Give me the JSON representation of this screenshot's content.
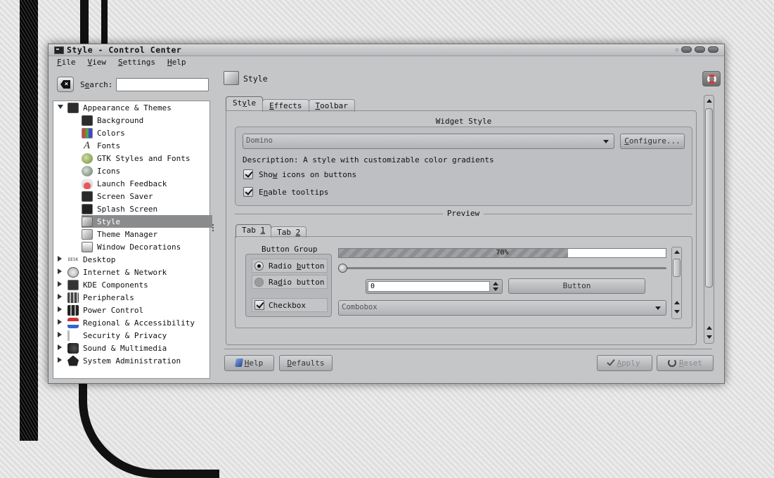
{
  "window": {
    "title": "Style - Control Center"
  },
  "menu": {
    "file": {
      "key": "F",
      "rest": "ile"
    },
    "view": {
      "key": "V",
      "rest": "iew"
    },
    "settings": {
      "key": "S",
      "rest": "ettings"
    },
    "help": {
      "key": "H",
      "rest": "elp"
    }
  },
  "search": {
    "label_pre": "S",
    "label_key": "e",
    "label_post": "arch:",
    "value": ""
  },
  "tree": {
    "appearance": "Appearance & Themes",
    "children": [
      {
        "label": "Background",
        "icon": "monitor-icon"
      },
      {
        "label": "Colors",
        "icon": "colors-icon"
      },
      {
        "label": "Fonts",
        "icon": "font-icon"
      },
      {
        "label": "GTK Styles and Fonts",
        "icon": "gtk-icon"
      },
      {
        "label": "Icons",
        "icon": "icons-icon"
      },
      {
        "label": "Launch Feedback",
        "icon": "launch-feedback-icon"
      },
      {
        "label": "Screen Saver",
        "icon": "screensaver-icon"
      },
      {
        "label": "Splash Screen",
        "icon": "splash-icon"
      },
      {
        "label": "Style",
        "icon": "style-icon",
        "selected": true
      },
      {
        "label": "Theme Manager",
        "icon": "theme-manager-icon"
      },
      {
        "label": "Window Decorations",
        "icon": "window-decorations-icon"
      }
    ],
    "categories": [
      {
        "label": "Desktop",
        "icon": "desktop-icon",
        "icon_text": "DESK"
      },
      {
        "label": "Internet & Network",
        "icon": "globe-icon"
      },
      {
        "label": "KDE Components",
        "icon": "kde-icon"
      },
      {
        "label": "Peripherals",
        "icon": "peripherals-icon"
      },
      {
        "label": "Power Control",
        "icon": "power-icon"
      },
      {
        "label": "Regional & Accessibility",
        "icon": "flag-icon"
      },
      {
        "label": "Security & Privacy",
        "icon": "security-icon"
      },
      {
        "label": "Sound & Multimedia",
        "icon": "sound-icon"
      },
      {
        "label": "System Administration",
        "icon": "system-icon"
      }
    ]
  },
  "header": {
    "title": "Style"
  },
  "tabs": {
    "style": {
      "pre": "St",
      "key": "y",
      "post": "le"
    },
    "effects": {
      "key": "E",
      "post": "ffects"
    },
    "toolbar": {
      "key": "T",
      "post": "oolbar"
    }
  },
  "widget_style": {
    "title": "Widget Style",
    "selected": "Domino",
    "configure": {
      "key": "C",
      "post": "onfigure..."
    },
    "description": "Description: A style with customizable color gradients",
    "show_icons": {
      "pre": "Sho",
      "key": "w",
      "post": " icons on buttons",
      "checked": true
    },
    "tooltips": {
      "pre": "E",
      "key": "n",
      "post": "able tooltips",
      "checked": true
    }
  },
  "preview": {
    "title": "Preview",
    "tab1": {
      "pre": "Tab ",
      "key": "1"
    },
    "tab2": {
      "pre": "Tab ",
      "key": "2"
    },
    "button_group_title": "Button Group",
    "radio1": {
      "pre": "Radio ",
      "key": "b",
      "post": "utton",
      "selected": true
    },
    "radio2": {
      "pre": "Ra",
      "key": "d",
      "post": "io button",
      "selected": false
    },
    "checkbox": {
      "label": "Checkbox",
      "checked": true
    },
    "progress": {
      "value": 70,
      "label": "70%"
    },
    "slider": {
      "value": 0
    },
    "spin_value": "0",
    "button_label": "Button",
    "combobox": "Combobox"
  },
  "footer": {
    "help": {
      "key": "H",
      "post": "elp"
    },
    "defaults": {
      "key": "D",
      "post": "efaults"
    },
    "apply": {
      "key": "A",
      "post": "pply",
      "enabled": false
    },
    "reset": {
      "key": "R",
      "post": "eset",
      "enabled": false
    }
  }
}
